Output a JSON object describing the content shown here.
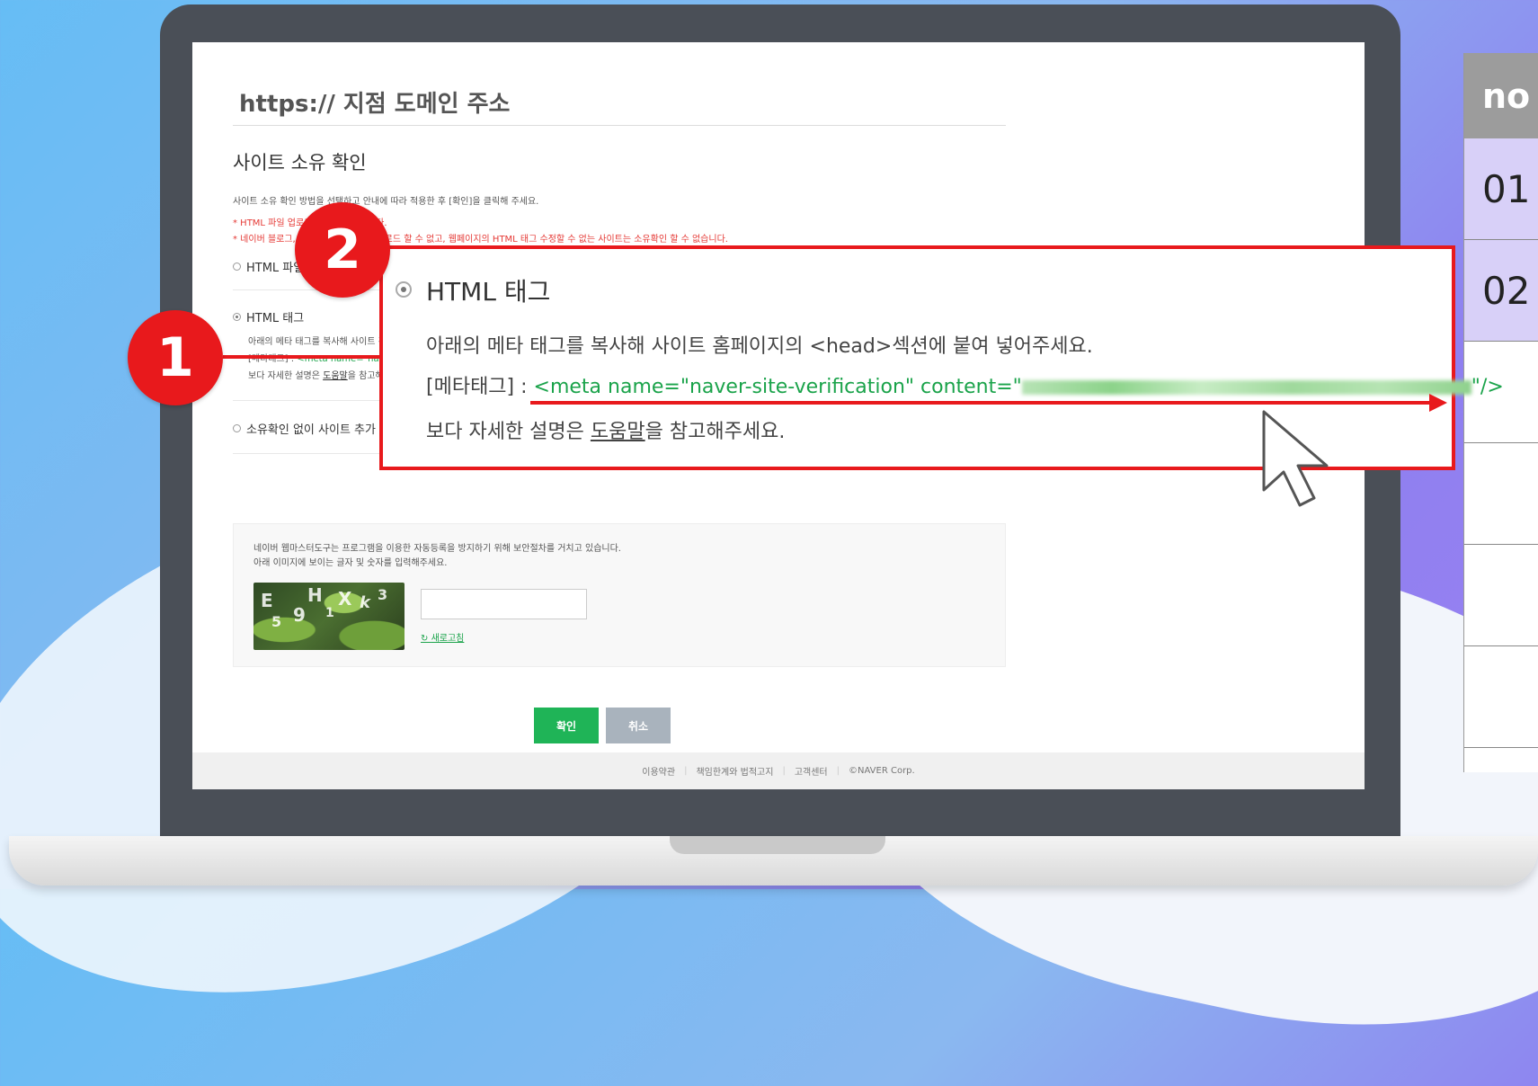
{
  "side_table": {
    "header": "no",
    "rows": [
      "01",
      "02",
      "",
      "",
      "",
      ""
    ]
  },
  "screen": {
    "page_title": "https:// 지점 도메인 주소",
    "section_title": "사이트 소유 확인",
    "description": "사이트 소유 확인 방법을 선택하고 안내에 따라 적용한 후 [확인]을 클릭해 주세요.",
    "warning1": "* HTML 파일 업로드 방법을 권장합니다.",
    "warning2": "* 네이버 블로그, 카페 등 HTML 파일 업로드 할 수 없고, 웹페이지의 HTML 태그 수정할 수 없는 사이트는 소유확인 할 수 없습니다.",
    "options": {
      "html_file": "HTML 파일 업로드",
      "html_tag": "HTML 태그",
      "no_verify": "소유확인 없이 사이트 추가"
    },
    "tag_detail": {
      "line1": "아래의 메타 태그를 복사해 사이트 홈페이지의 <head>섹션에 붙여 넣어주세요.",
      "line2_prefix": "[메타태그] : ",
      "line2_meta": "<meta name=\"naver-site-verification\" content=\"",
      "line3_prefix": "보다 자세한 설명은 ",
      "line3_link": "도움말",
      "line3_suffix": "을 참고해주세요."
    },
    "captcha": {
      "line1": "네이버 웹마스터도구는 프로그램을 이용한 자동등록을 방지하기 위해 보안절차를 거치고 있습니다.",
      "line2": "아래 이미지에 보이는 글자 및 숫자를 입력해주세요.",
      "input_value": "",
      "refresh_label": "새로고침",
      "image_chars": [
        "E",
        "5",
        "9",
        "H",
        "1",
        "X",
        "k",
        "3"
      ]
    },
    "buttons": {
      "ok": "확인",
      "cancel": "취소"
    },
    "footer": [
      "이용약관",
      "책임한계와 법적고지",
      "고객센터",
      "©NAVER Corp."
    ]
  },
  "callout": {
    "title": "HTML 태그",
    "line1": "아래의 메타 태그를 복사해 사이트 홈페이지의 <head>섹션에 붙여 넣어주세요.",
    "line2_prefix": "[메타태그] : ",
    "line2_meta": "<meta name=\"naver-site-verification\" content=\"",
    "line2_suffix": "\"/>",
    "line3_prefix": "보다 자세한 설명은 ",
    "line3_link": "도움말",
    "line3_suffix": "을 참고해주세요."
  },
  "badges": [
    "1",
    "2"
  ],
  "colors": {
    "accent_red": "#e8191c",
    "naver_green": "#1fb457",
    "meta_green": "#1aa34a"
  }
}
